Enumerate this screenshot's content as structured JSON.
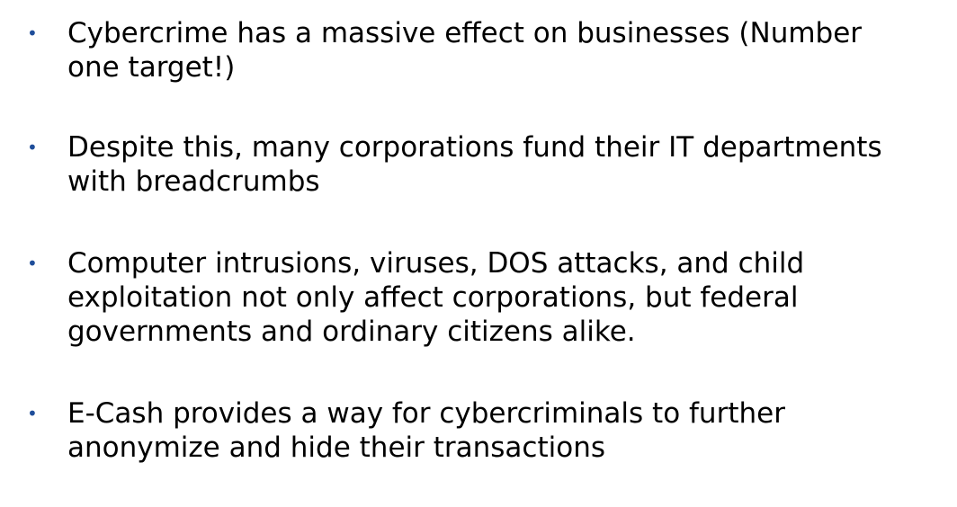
{
  "bullets": [
    {
      "marker": "•",
      "lines": [
        "Cybercrime has a massive effect on businesses (Number",
        "one target!)"
      ]
    },
    {
      "marker": "•",
      "lines": [
        "Despite this, many corporations fund their IT departments",
        "with breadcrumbs"
      ]
    },
    {
      "marker": "•",
      "lines": [
        "Computer intrusions, viruses, DOS attacks, and child",
        "exploitation not only affect corporations, but federal",
        "governments and ordinary citizens alike."
      ]
    },
    {
      "marker": "•",
      "lines": [
        "E-Cash provides a way for cybercriminals to further",
        "anonymize and hide their transactions"
      ]
    }
  ],
  "colors": {
    "text": "#000000",
    "bullet": "#1f4e9a",
    "background": "#ffffff"
  }
}
